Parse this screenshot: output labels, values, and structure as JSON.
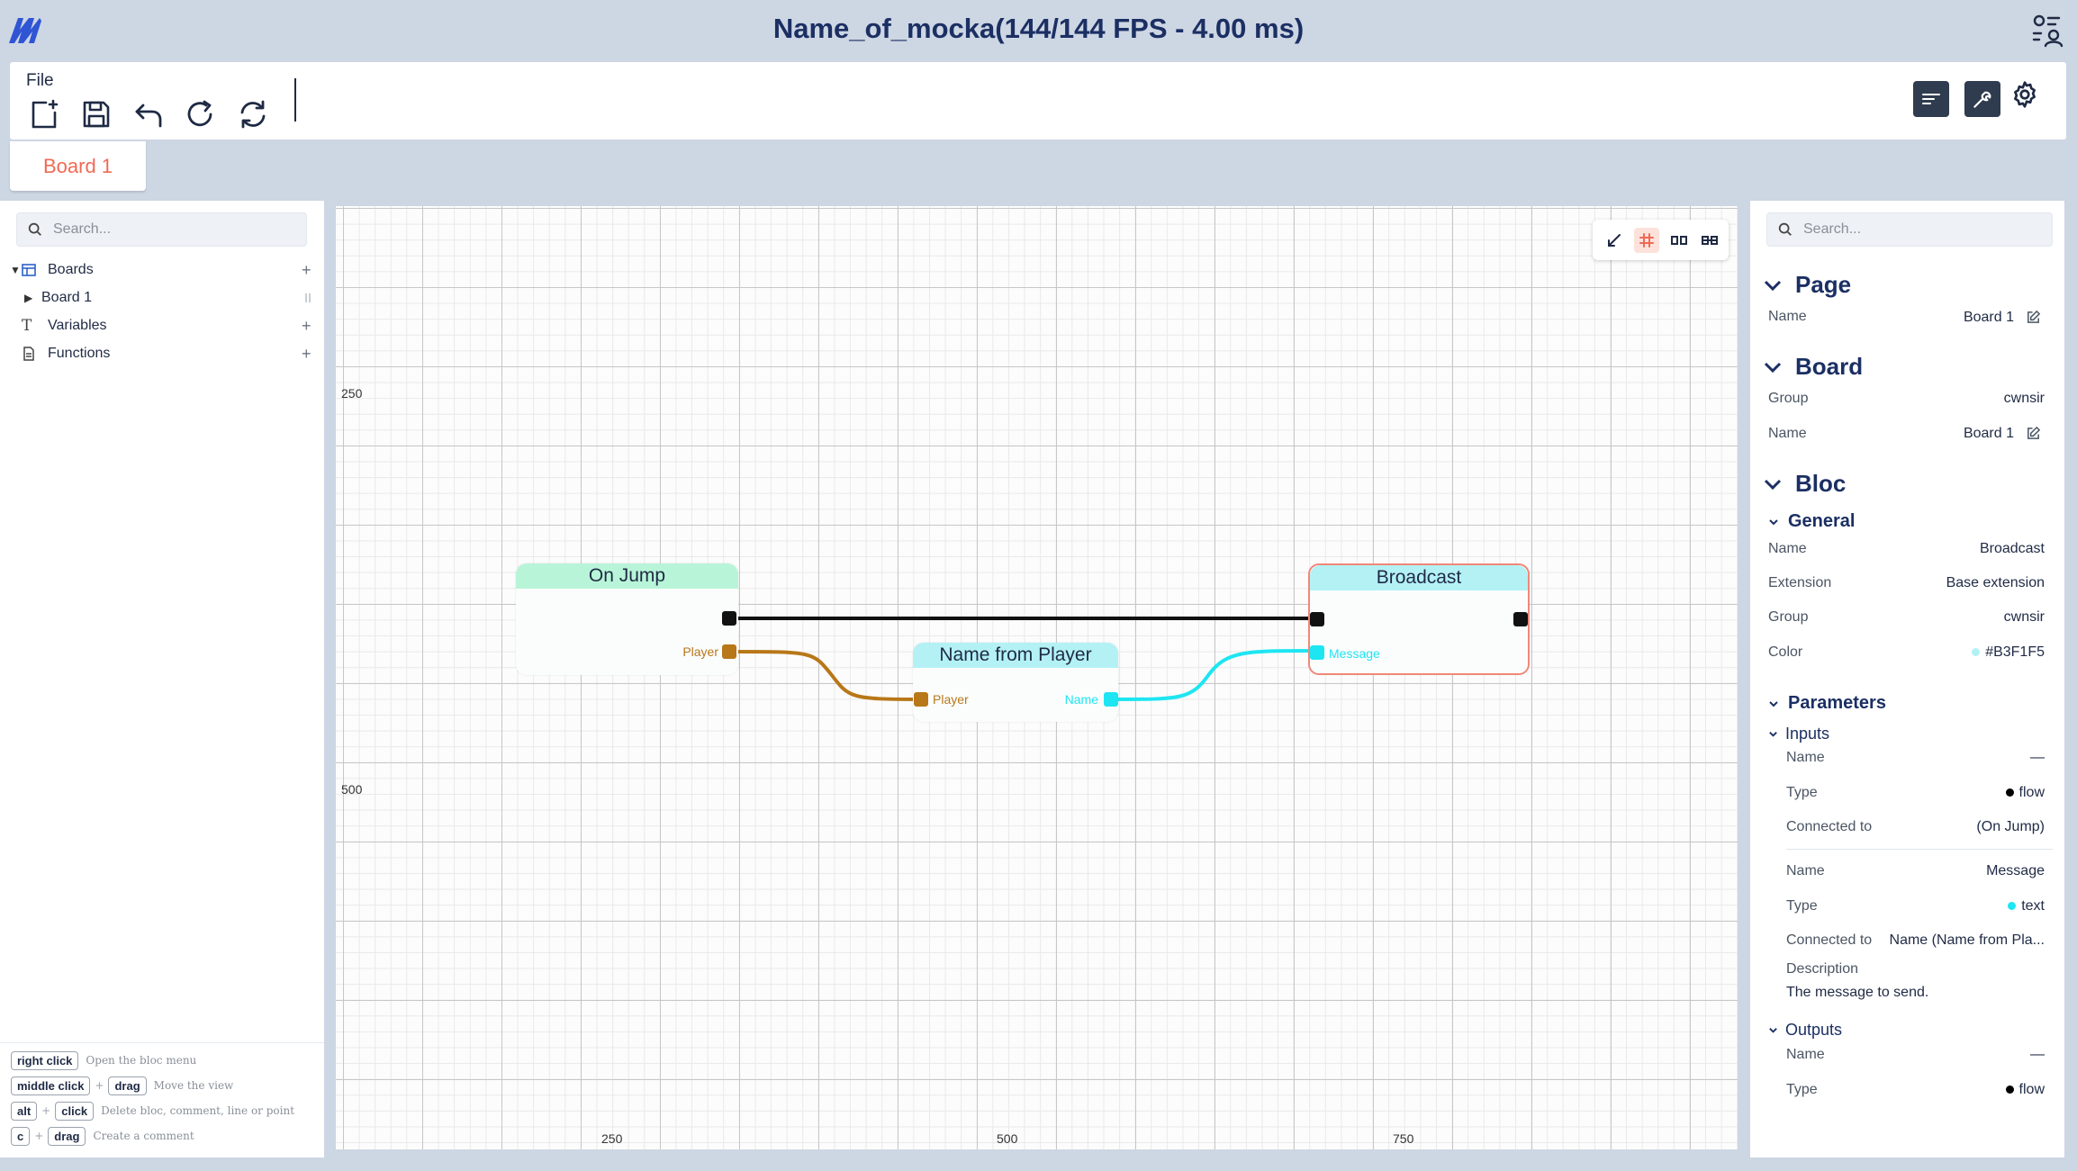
{
  "app": {
    "title": "Name_of_mocka(144/144 FPS - 4.00 ms)",
    "file_menu": "File"
  },
  "tabs": [
    {
      "label": "Board 1"
    }
  ],
  "left_panel": {
    "search_placeholder": "Search...",
    "tree": [
      {
        "label": "Boards",
        "icon": "boards-icon"
      },
      {
        "label": "Board 1",
        "icon": "none"
      },
      {
        "label": "Variables",
        "icon": "text-icon"
      },
      {
        "label": "Functions",
        "icon": "file-icon"
      }
    ],
    "shortcuts": [
      {
        "keys": [
          "right click"
        ],
        "desc": "Open the bloc menu"
      },
      {
        "keys": [
          "middle click",
          "drag"
        ],
        "desc": "Move the view"
      },
      {
        "keys": [
          "alt",
          "click"
        ],
        "desc": "Delete bloc, comment, line or point"
      },
      {
        "keys": [
          "c",
          "drag"
        ],
        "desc": "Create a comment"
      }
    ]
  },
  "canvas": {
    "axis_labels": {
      "y250": "250",
      "y500": "500",
      "x250": "250",
      "x500": "500",
      "x750": "750"
    },
    "nodes": {
      "on_jump": {
        "title": "On Jump",
        "header_color": "#B8F5D8",
        "out_label": "Player"
      },
      "name_from_player": {
        "title": "Name from Player",
        "header_color": "#B3F1F5",
        "in_label": "Player",
        "out_label": "Name"
      },
      "broadcast": {
        "title": "Broadcast",
        "header_color": "#B3F1F5",
        "in_label": "Message"
      }
    },
    "colors": {
      "flow": "#000000",
      "player": "#B87718",
      "text": "#1EE5F2",
      "selected": "#F08878"
    }
  },
  "right_panel": {
    "search_placeholder": "Search...",
    "page": {
      "heading": "Page",
      "name_label": "Name",
      "name_value": "Board 1"
    },
    "board": {
      "heading": "Board",
      "group_label": "Group",
      "group_value": "cwnsir",
      "name_label": "Name",
      "name_value": "Board 1"
    },
    "bloc": {
      "heading": "Bloc",
      "general": {
        "heading": "General",
        "name_label": "Name",
        "name_value": "Broadcast",
        "extension_label": "Extension",
        "extension_value": "Base extension",
        "group_label": "Group",
        "group_value": "cwnsir",
        "color_label": "Color",
        "color_value": "#B3F1F5"
      },
      "parameters": {
        "heading": "Parameters",
        "inputs": {
          "heading": "Inputs",
          "items": [
            {
              "name_label": "Name",
              "name_value": "—",
              "type_label": "Type",
              "type_value": "flow",
              "type_color": "#000000",
              "conn_label": "Connected to",
              "conn_value": "(On Jump)"
            },
            {
              "name_label": "Name",
              "name_value": "Message",
              "type_label": "Type",
              "type_value": "text",
              "type_color": "#1EE5F2",
              "conn_label": "Connected to",
              "conn_value": "Name (Name from Pla...",
              "desc_label": "Description",
              "desc_value": "The message to send."
            }
          ]
        },
        "outputs": {
          "heading": "Outputs",
          "items": [
            {
              "name_label": "Name",
              "name_value": "—",
              "type_label": "Type",
              "type_value": "flow",
              "type_color": "#000000"
            }
          ]
        }
      }
    }
  }
}
